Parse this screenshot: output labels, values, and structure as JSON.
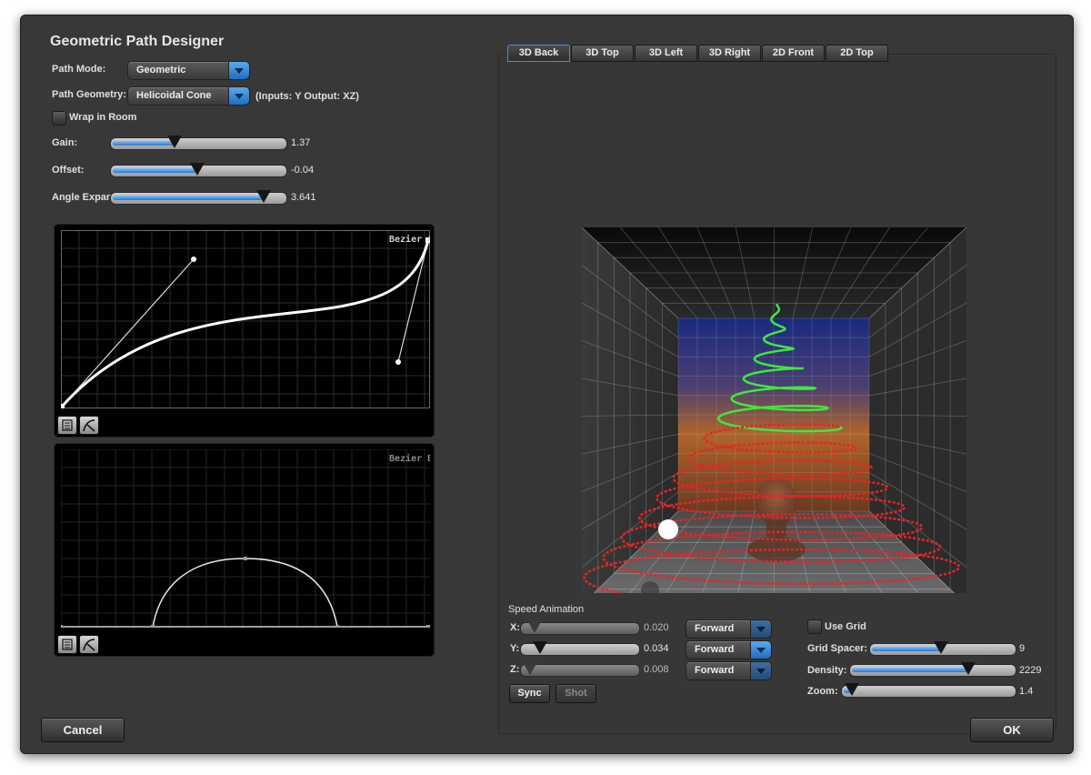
{
  "app": {
    "title": "Geometric Path Designer"
  },
  "path_mode": {
    "label": "Path Mode:",
    "value": "Geometric"
  },
  "path_geometry": {
    "label": "Path Geometry:",
    "value": "Helicoidal Cone",
    "note": "(Inputs: Y Output: XZ)"
  },
  "wrap": {
    "label": "Wrap in Room",
    "checked": false
  },
  "sliders": {
    "gain": {
      "label": "Gain:",
      "value": "1.37",
      "fraction": 0.36
    },
    "offset": {
      "label": "Offset:",
      "value": "-0.04",
      "fraction": 0.49
    },
    "angle": {
      "label": "Angle Expan",
      "value": "3.641",
      "fraction": 0.88
    }
  },
  "bezier_a": {
    "label": "Bezier A"
  },
  "bezier_b": {
    "label": "Bezier B"
  },
  "view_tabs": [
    "3D Back",
    "3D Top",
    "3D Left",
    "3D Right",
    "2D Front",
    "2D Top"
  ],
  "active_tab": "3D Back",
  "speed": {
    "title": "Speed Animation",
    "rows": [
      {
        "axis": "X:",
        "value": "0.020",
        "direction": "Forward",
        "fraction": 0.1
      },
      {
        "axis": "Y:",
        "value": "0.034",
        "direction": "Forward",
        "fraction": 0.15
      },
      {
        "axis": "Z:",
        "value": "0.008",
        "direction": "Forward",
        "fraction": 0.06
      }
    ],
    "sync": "Sync",
    "shot": "Shot"
  },
  "grid": {
    "use_grid": {
      "label": "Use Grid",
      "checked": false
    },
    "spacer": {
      "label": "Grid Spacer:",
      "value": "9",
      "fraction": 0.49
    },
    "density": {
      "label": "Density:",
      "value": "2229",
      "fraction": 0.72
    },
    "zoom": {
      "label": "Zoom:",
      "value": "1.4",
      "fraction": 0.05
    }
  },
  "buttons": {
    "cancel": "Cancel",
    "ok": "OK"
  },
  "colors": {
    "accent": "#2a79d0",
    "path_upper": "#3ee83e",
    "path_lower": "#ee2222"
  }
}
